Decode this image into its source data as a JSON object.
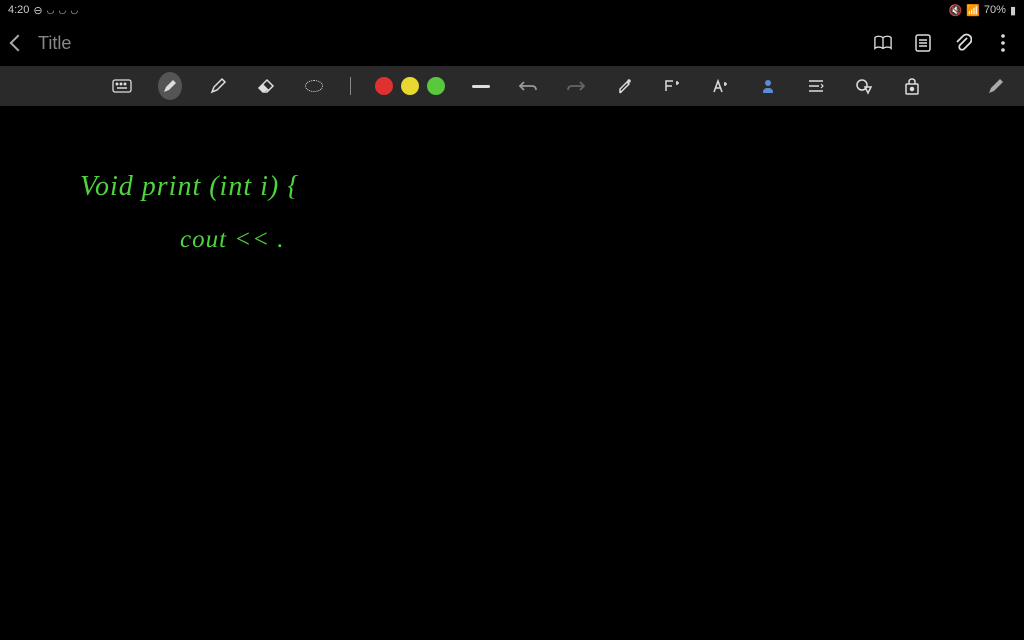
{
  "statusbar": {
    "time": "4:20",
    "battery": "70%"
  },
  "header": {
    "title": "Title"
  },
  "toolbar": {
    "colors": {
      "red": "#e03030",
      "yellow": "#e8d830",
      "green": "#5ac83c"
    }
  },
  "canvas": {
    "line1": "Void   print (int i)  {",
    "line2": "cout <<   ."
  }
}
